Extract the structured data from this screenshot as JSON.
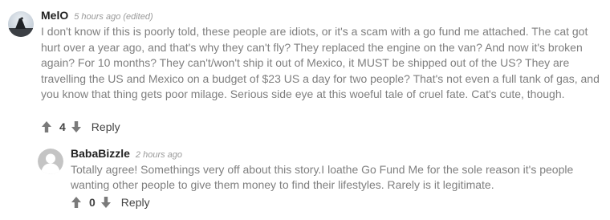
{
  "comments": [
    {
      "author": "MelO",
      "time": "5 hours ago",
      "edited": "(edited)",
      "text": "I don't know if this is poorly told, these people are idiots, or it's a scam with a go fund me attached. The cat got hurt over a year ago, and that's why they can't fly? They replaced the engine on the van? And now it's broken again? For 10 months? They can't/won't ship it out of Mexico, it MUST be shipped out of the US? They are travelling the US and Mexico on a budget of $23 US a day for two people? That's not even a full tank of gas, and you know that thing gets poor milage. Serious side eye at this woeful tale of cruel fate. Cat's cute, though.",
      "votes": "4",
      "reply_label": "Reply",
      "avatar_icon": "user-photo-avatar"
    },
    {
      "author": "BabaBizzle",
      "time": "2 hours ago",
      "text": "Totally agree! Somethings very off about this story.I loathe Go Fund Me for the sole reason it's people wanting other people to give them money to find their lifestyles. Rarely is it legitimate.",
      "votes": "0",
      "reply_label": "Reply",
      "avatar_icon": "default-user-avatar"
    }
  ],
  "colors": {
    "author": "#222222",
    "timestamp": "#9a9a9a",
    "body_text": "#7f7f7f",
    "vote_icon": "#7a7a7a",
    "avatar_placeholder": "#c4c4c4"
  },
  "icons": {
    "upvote": "arrow-up-icon",
    "downvote": "arrow-down-icon"
  }
}
